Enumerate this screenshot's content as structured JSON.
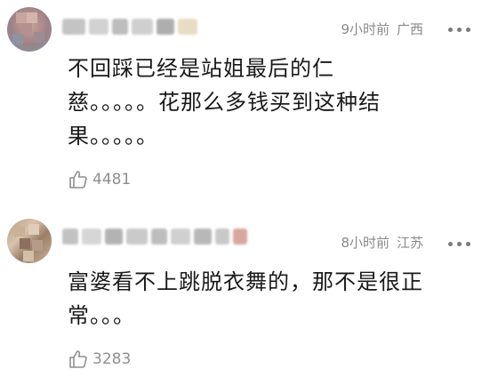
{
  "comments": [
    {
      "time": "9小时前",
      "location": "广西",
      "text": "不回踩已经是站姐最后的仁\n慈。。。。。花那么多钱买到这种结\n果。。。。。",
      "likes": "4481"
    },
    {
      "time": "8小时前",
      "location": "江苏",
      "text": "富婆看不上跳脱衣舞的，那不是很正\n常。。。",
      "likes": "3283"
    }
  ],
  "colors": {
    "meta_text": "#8a8a8a",
    "body_text": "#1a1a1a",
    "likes_text": "#8f8f8f"
  }
}
